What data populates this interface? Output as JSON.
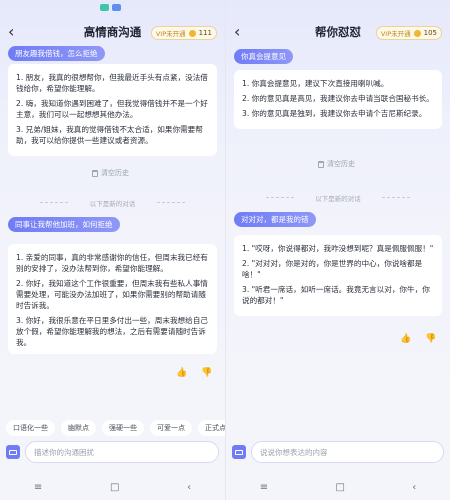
{
  "left": {
    "title": "高情商沟通",
    "vip_label": "VIP未开通",
    "credits": "111",
    "tag1": "朋友趣我借钱，怎么拒绝",
    "card1": [
      "1. 朋友，我真的很想帮你，但我最近手头有点紧，没法借钱给你，希望你能理解。",
      "2. 嗨，我知道你遇到困难了，但我觉得借钱并不是一个好主意，我们可以一起想想其他办法。",
      "3. 兄弟/姐妹，我真的觉得借钱不太合适，如果你需要帮助，我可以给你提供一些建议或者资源。"
    ],
    "clear_label": "清空历史",
    "divider": "以下是新的对话",
    "tag2": "同事让我帮他加班，如何拒绝",
    "card2": [
      "1. 亲爱的同事，真的非常感谢你的信任，但周末我已经有别的安排了，没办法帮到你，希望你能理解。",
      "2. 你好，我知道这个工作很重要，但周末我有些私人事情需要处理，可能没办法加班了，如果你需要别的帮助请随时告诉我。",
      "3. 你好，我很乐意在平日里多付出一些，周末我想给自己放个假，希望你能理解我的想法，之后有需要请随时告诉我。"
    ],
    "chips": [
      "口语化一些",
      "幽默点",
      "强硬一些",
      "可爱一点",
      "正式点"
    ],
    "placeholder": "描述你的沟通困扰"
  },
  "right": {
    "title": "帮你怼怼",
    "vip_label": "VIP未开通",
    "credits": "105",
    "tag1": "你真会提意见",
    "card1": [
      "1. 你真会提意见，建议下次直接用喇叭喊。",
      "2. 你的意见真是高见，我建议你去申请当联合国秘书长。",
      "3. 你的意见真是独到，我建议你去申请个吉尼斯纪录。"
    ],
    "clear_label": "清空历史",
    "divider": "以下是新的对话",
    "tag2": "对对对，都是我的错",
    "card2": [
      "1. \"哎呀，你说得都对，我咋没想到呢？真是佩服佩服！\"",
      "2. \"对对对，你是对的，你是世界的中心，你说啥都是啥！\"",
      "3. \"听君一席话，如听一席话。我竟无言以对，你牛，你说的都对！\""
    ],
    "placeholder": "说说你想表达的内容"
  },
  "nav": {
    "menu": "≡",
    "home": "□",
    "back": "‹"
  },
  "colors": {
    "accent": "#6f7cf5",
    "vip_gold": "#f2b531"
  }
}
